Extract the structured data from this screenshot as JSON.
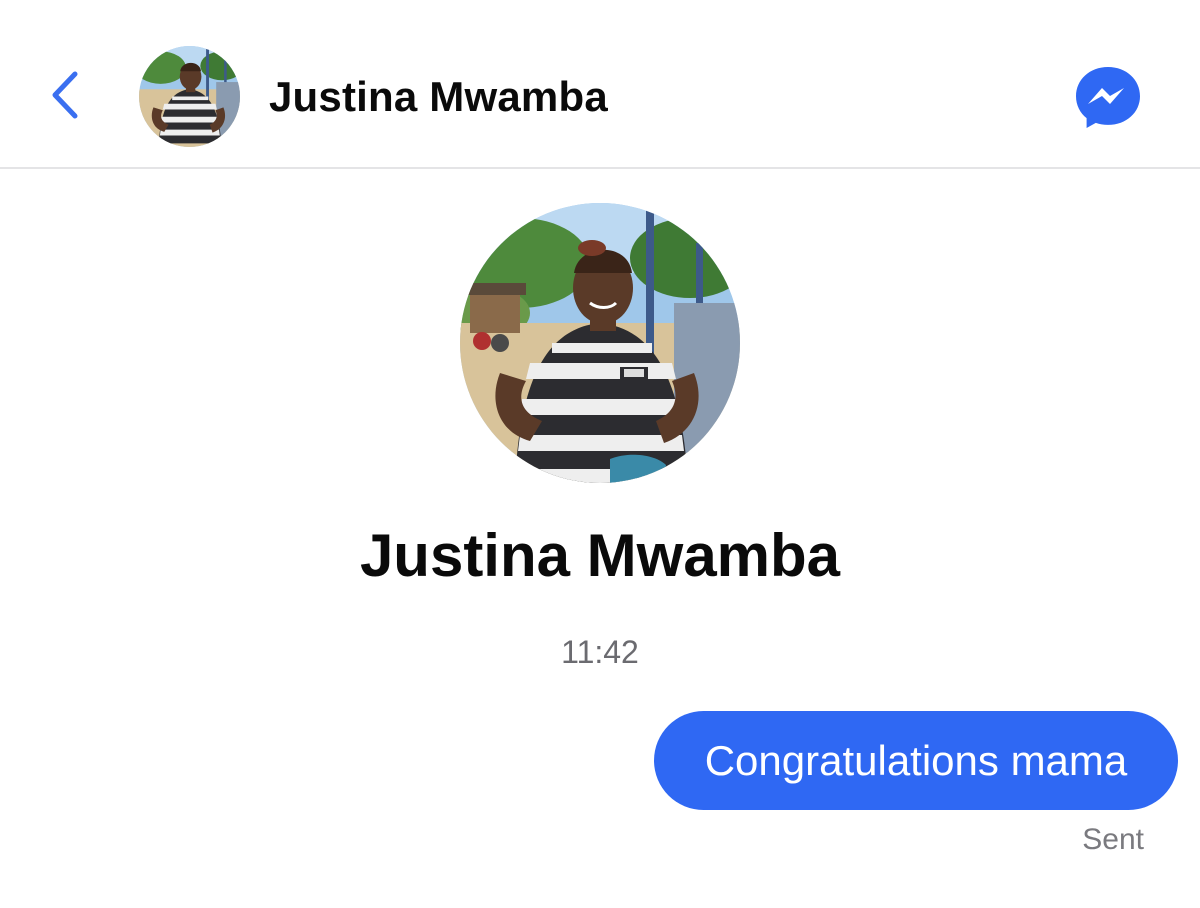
{
  "header": {
    "back_icon": "chevron-left-icon",
    "avatar_icon": "profile-photo",
    "contact_name": "Justina Mwamba",
    "app_icon": "messenger-icon"
  },
  "profile": {
    "avatar_icon": "profile-photo",
    "name": "Justina Mwamba"
  },
  "conversation": {
    "timestamp": "11:42",
    "messages": [
      {
        "direction": "outgoing",
        "text": "Congratulations mama",
        "status": "Sent"
      }
    ]
  },
  "colors": {
    "accent": "#2f68f3",
    "back_chevron": "#3a6ff0",
    "text_primary": "#0a0a0a",
    "text_secondary": "#6b6b70",
    "divider": "#e4e4e6"
  }
}
